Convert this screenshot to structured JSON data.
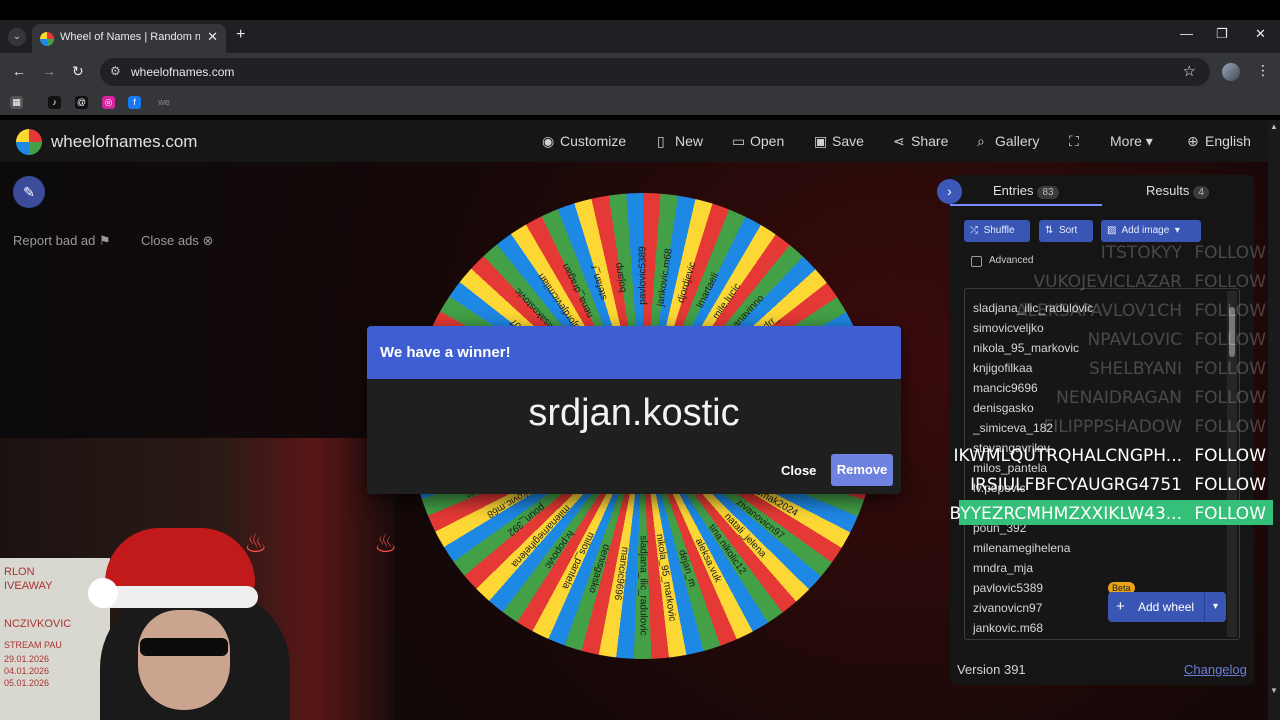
{
  "browser": {
    "tab_title": "Wheel of Names | Random name picker",
    "tab_close": "✕",
    "new_tab": "+",
    "url": "wheelofnames.com",
    "bookmarks": [
      "tiktok",
      "threads",
      "instagram",
      "facebook",
      "we"
    ]
  },
  "header": {
    "site": "wheelofnames.com",
    "nav": [
      "Customize",
      "New",
      "Open",
      "Save",
      "Share",
      "Gallery",
      "More",
      "English"
    ]
  },
  "ads": {
    "report": "Report bad ad",
    "close": "Close ads"
  },
  "wheel": {
    "colors": [
      "#e53935",
      "#43a047",
      "#1e88e5",
      "#fdd835"
    ],
    "labels": [
      "pavlovic5389",
      "jankovic.m68",
      "djordjevic",
      "lmartaeli",
      "mile.lucic",
      "Joanavinno",
      "alexandrr_",
      "ivanba",
      "smartaeli",
      "roksanovic",
      "spasa",
      "tomic1982",
      "zakitstanic",
      "vasic1987",
      "momak2024",
      "zivanovicn97",
      "natali_jelena",
      "tina.nikolic12",
      "aleksa.vuk",
      "dejan_m",
      "nikola_95_markovic",
      "sladjana_ilic_radulovic",
      "mancic9696",
      "denisgasko",
      "milos_pantela",
      "lv.popovic",
      "milenamegihelena",
      "poun_392",
      "jankovic.m68",
      "milanceljovanovic",
      "fitness_ns_hr",
      "djordjevic_s",
      "mndra_mja",
      "pavlovic5389",
      "zivanovicn97",
      "marija1994",
      "fellow07",
      "iiivanisakostovic",
      "djordjevicmilan",
      "nena_dragan",
      "stefan_r",
      "bojanp"
    ]
  },
  "webcam": {
    "whiteboard_lines": [
      "RLON",
      "IVEAWAY",
      "",
      "NCZIVKOVIC",
      "STREAM PAU",
      "29.01.2026",
      "04.01.2026",
      "05.01.2026"
    ]
  },
  "panel": {
    "tab_entries": "Entries",
    "entries_count": "83",
    "tab_results": "Results",
    "results_count": "4",
    "shuffle": "Shuffle",
    "sort": "Sort",
    "add_image": "Add image",
    "advanced": "Advanced",
    "entries": [
      "sladjana_ilic_radulovic",
      "simovicveljko",
      "nikola_95_markovic",
      "knjigofilkaa",
      "mancic9696",
      "denisgasko",
      "_simiceva_182",
      "stevangavrilov",
      "milos_pantela",
      "lv.popovic",
      "",
      "poun_392",
      "milenamegihelena",
      "mndra_mja",
      "pavlovic5389",
      "zivanovicn97",
      "jankovic.m68"
    ],
    "beta": "Beta",
    "add_wheel": "Add wheel",
    "version": "Version 391",
    "changelog": "Changelog"
  },
  "chat": [
    {
      "name": "ITSTOKYY",
      "action": "FOLLOW"
    },
    {
      "name": "VUKOJEVICLAZAR",
      "action": "FOLLOW"
    },
    {
      "name": "ALEKSAPAVLOV1CH",
      "action": "FOLLOW"
    },
    {
      "name": "NPAVLOVIC",
      "action": "FOLLOW"
    },
    {
      "name": "SHELBYANI",
      "action": "FOLLOW"
    },
    {
      "name": "NENAIDRAGAN",
      "action": "FOLLOW"
    },
    {
      "name": "FILIPPPSHADOW",
      "action": "FOLLOW"
    },
    {
      "name": "IKWMLQUTRQHALCNGPH...",
      "action": "FOLLOW"
    },
    {
      "name": "IRSIULFBFCYAUGRG4751",
      "action": "FOLLOW"
    },
    {
      "name": "BYYEZRCMHMZXXIKLW43...",
      "action": "FOLLOW"
    }
  ],
  "modal": {
    "title": "We have a winner!",
    "winner": "srdjan.kostic",
    "close": "Close",
    "remove": "Remove"
  }
}
